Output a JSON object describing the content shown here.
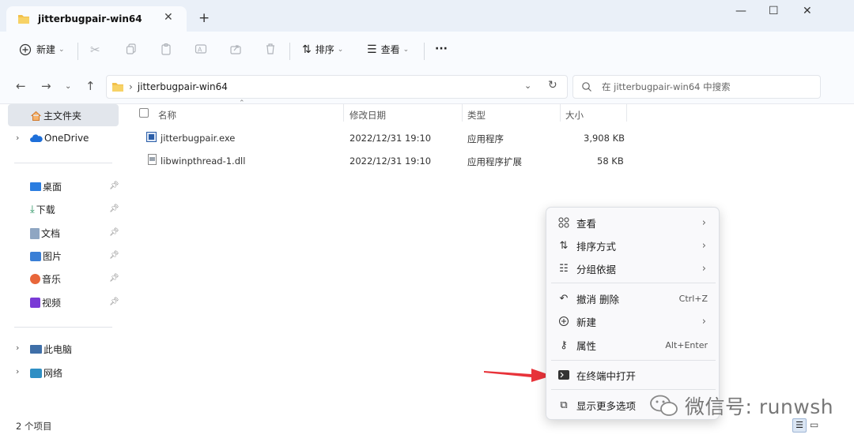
{
  "window": {
    "tab_title": "jitterbugpair-win64",
    "tab_close": "✕",
    "new_tab": "+",
    "minimize": "—",
    "maximize": "☐",
    "close": "✕"
  },
  "toolbar": {
    "new_label": "新建",
    "sort_label": "排序",
    "view_label": "查看",
    "more_label": "···"
  },
  "address": {
    "path_folder": "jitterbugpair-win64",
    "search_placeholder": "在 jitterbugpair-win64 中搜索"
  },
  "sidebar": {
    "home": "主文件夹",
    "onedrive": "OneDrive",
    "quick": [
      {
        "label": "桌面",
        "icon": "desktop-icon"
      },
      {
        "label": "下载",
        "icon": "download-icon"
      },
      {
        "label": "文档",
        "icon": "document-icon"
      },
      {
        "label": "图片",
        "icon": "pictures-icon"
      },
      {
        "label": "音乐",
        "icon": "music-icon"
      },
      {
        "label": "视频",
        "icon": "video-icon"
      }
    ],
    "this_pc": "此电脑",
    "network": "网络"
  },
  "file_list": {
    "headers": {
      "name": "名称",
      "modified": "修改日期",
      "type": "类型",
      "size": "大小"
    },
    "rows": [
      {
        "name": "jitterbugpair.exe",
        "modified": "2022/12/31 19:10",
        "type": "应用程序",
        "size": "3,908 KB",
        "icon": "exe-file-icon"
      },
      {
        "name": "libwinpthread-1.dll",
        "modified": "2022/12/31 19:10",
        "type": "应用程序扩展",
        "size": "58 KB",
        "icon": "dll-file-icon"
      }
    ]
  },
  "context_menu": {
    "items": [
      {
        "label": "查看",
        "shortcut": "",
        "arrow": "›",
        "icon": "view-grid-icon"
      },
      {
        "label": "排序方式",
        "shortcut": "",
        "arrow": "›",
        "icon": "sort-icon"
      },
      {
        "label": "分组依据",
        "shortcut": "",
        "arrow": "›",
        "icon": "group-icon"
      },
      {
        "label": "撤消 删除",
        "shortcut": "Ctrl+Z",
        "arrow": "",
        "icon": "undo-icon"
      },
      {
        "label": "新建",
        "shortcut": "",
        "arrow": "›",
        "icon": "new-plus-icon"
      },
      {
        "label": "属性",
        "shortcut": "Alt+Enter",
        "arrow": "",
        "icon": "properties-key-icon"
      },
      {
        "label": "在终端中打开",
        "shortcut": "",
        "arrow": "",
        "icon": "terminal-icon"
      },
      {
        "label": "显示更多选项",
        "shortcut": "",
        "arrow": "",
        "icon": "more-options-icon"
      }
    ]
  },
  "status": {
    "item_count": "2 个项目"
  },
  "watermark": {
    "text": "微信号: runwsh"
  },
  "colors": {
    "arrow": "#e8333a",
    "folder": "#f2c04a",
    "accent": "#1e6fd9"
  }
}
